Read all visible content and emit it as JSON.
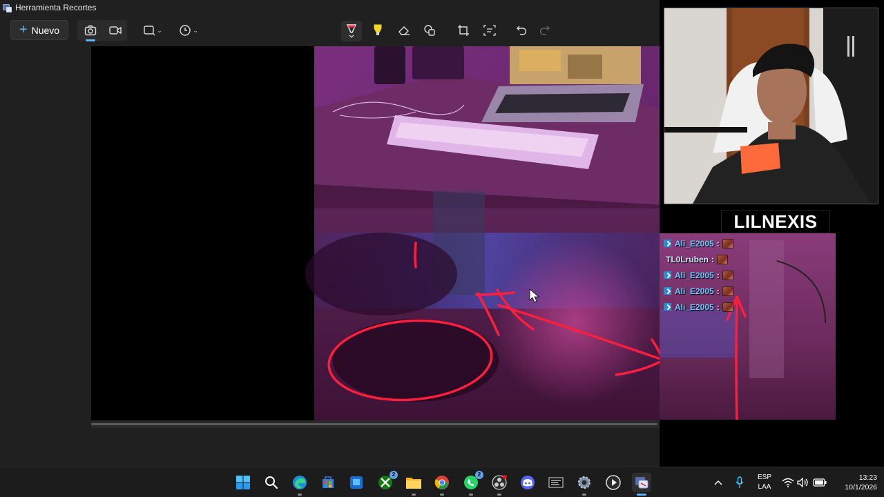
{
  "window": {
    "title": "Herramienta Recortes",
    "icon": "snipping-tool-icon"
  },
  "toolbar": {
    "new_label": "Nuevo",
    "tools": [
      "camera-icon",
      "video-icon",
      "rectangle-mode-icon",
      "delay-timer-icon",
      "ballpoint-pen-icon",
      "highlighter-icon",
      "eraser-icon",
      "shapes-icon",
      "crop-icon",
      "text-actions-icon",
      "undo-icon",
      "redo-icon"
    ],
    "active_mode": "camera-icon",
    "active_tool": "ballpoint-pen-icon"
  },
  "stream": {
    "streamer_name": "LILNEXIS",
    "chat": [
      {
        "user": "Ali_E2005",
        "sep": ":",
        "badge": true
      },
      {
        "user": "TL0Lruben",
        "sep": ":",
        "badge": false
      },
      {
        "user": "Ali_E2005",
        "sep": ":",
        "badge": true
      },
      {
        "user": "Ali_E2005",
        "sep": ":",
        "badge": true
      },
      {
        "user": "Ali_E2005",
        "sep": ":",
        "badge": true
      }
    ]
  },
  "taskbar": {
    "apps": [
      "windows-start-icon",
      "search-icon",
      "edge-icon",
      "store-icon",
      "blue-app-icon",
      "xbox-icon",
      "file-explorer-icon",
      "chrome-icon",
      "whatsapp-icon",
      "obs-icon",
      "discord-icon",
      "launcher-icon",
      "settings-icon",
      "media-player-icon",
      "snipping-tool-icon"
    ],
    "xbox_badge": "2",
    "whatsapp_badge": "2",
    "lang_line1": "ESP",
    "lang_line2": "LAA",
    "time": "13:23",
    "date": "10/1/2026"
  },
  "colors": {
    "accent": "#5fb2ff",
    "annotation": "#ff1e3c",
    "background": "#202020"
  }
}
